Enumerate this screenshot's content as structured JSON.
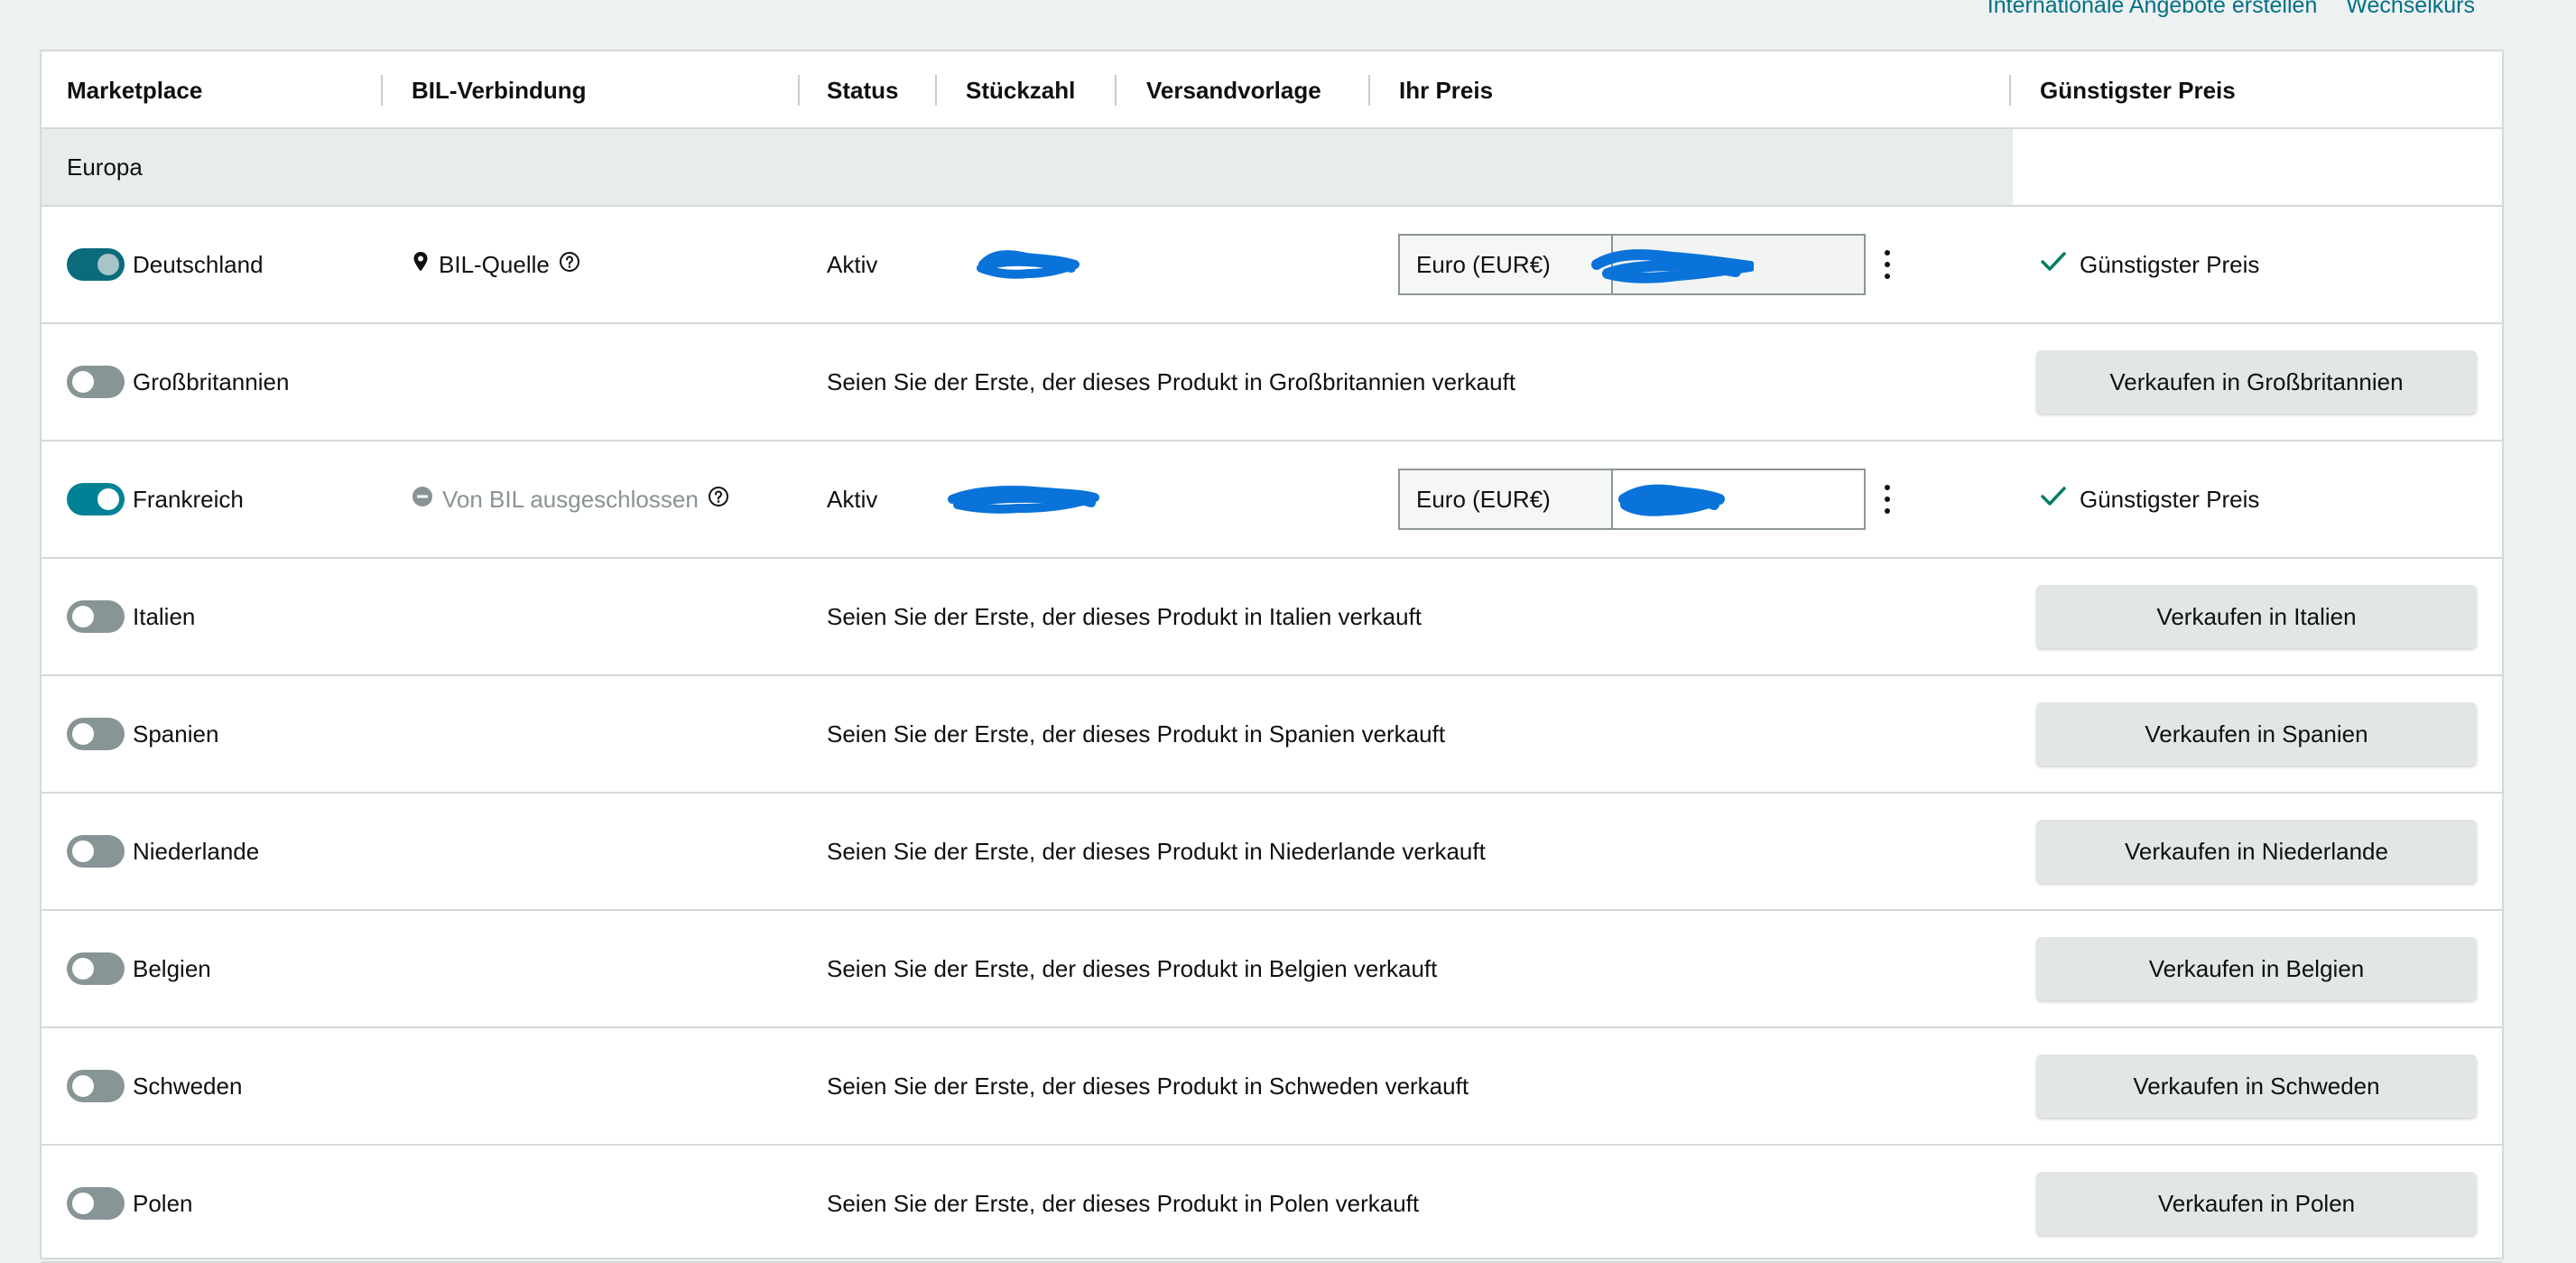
{
  "top_links": {
    "international_offers": "Internationale Angebote erstellen",
    "exchange_rate": "Wechselkurs"
  },
  "columns": {
    "marketplace": "Marketplace",
    "bil_connection": "BIL-Verbindung",
    "status": "Status",
    "quantity": "Stückzahl",
    "shipping_template": "Versandvorlage",
    "your_price": "Ihr Preis",
    "lowest_price": "Günstigster Preis"
  },
  "region": "Europa",
  "rows": [
    {
      "country": "Deutschland",
      "enabled": true,
      "bil": "BIL-Quelle",
      "status": "Aktiv",
      "currency": "Euro (EUR€)",
      "lowest": "Günstigster Preis"
    },
    {
      "country": "Großbritannien",
      "enabled": false,
      "message": "Seien Sie der Erste, der dieses Produkt in Großbritannien verkauft",
      "button": "Verkaufen in Großbritannien"
    },
    {
      "country": "Frankreich",
      "enabled": true,
      "bil": "Von BIL ausgeschlossen",
      "status": "Aktiv",
      "currency": "Euro (EUR€)",
      "lowest": "Günstigster Preis"
    },
    {
      "country": "Italien",
      "enabled": false,
      "message": "Seien Sie der Erste, der dieses Produkt in Italien verkauft",
      "button": "Verkaufen in Italien"
    },
    {
      "country": "Spanien",
      "enabled": false,
      "message": "Seien Sie der Erste, der dieses Produkt in Spanien verkauft",
      "button": "Verkaufen in Spanien"
    },
    {
      "country": "Niederlande",
      "enabled": false,
      "message": "Seien Sie der Erste, der dieses Produkt in Niederlande verkauft",
      "button": "Verkaufen in Niederlande"
    },
    {
      "country": "Belgien",
      "enabled": false,
      "message": "Seien Sie der Erste, der dieses Produkt in Belgien verkauft",
      "button": "Verkaufen in Belgien"
    },
    {
      "country": "Schweden",
      "enabled": false,
      "message": "Seien Sie der Erste, der dieses Produkt in Schweden verkauft",
      "button": "Verkaufen in Schweden"
    },
    {
      "country": "Polen",
      "enabled": false,
      "message": "Seien Sie der Erste, der dieses Produkt in Polen verkauft",
      "button": "Verkaufen in Polen"
    }
  ],
  "colors": {
    "accent": "#008296",
    "link": "#007185",
    "redaction": "#0a73d9",
    "check": "#067d62"
  }
}
